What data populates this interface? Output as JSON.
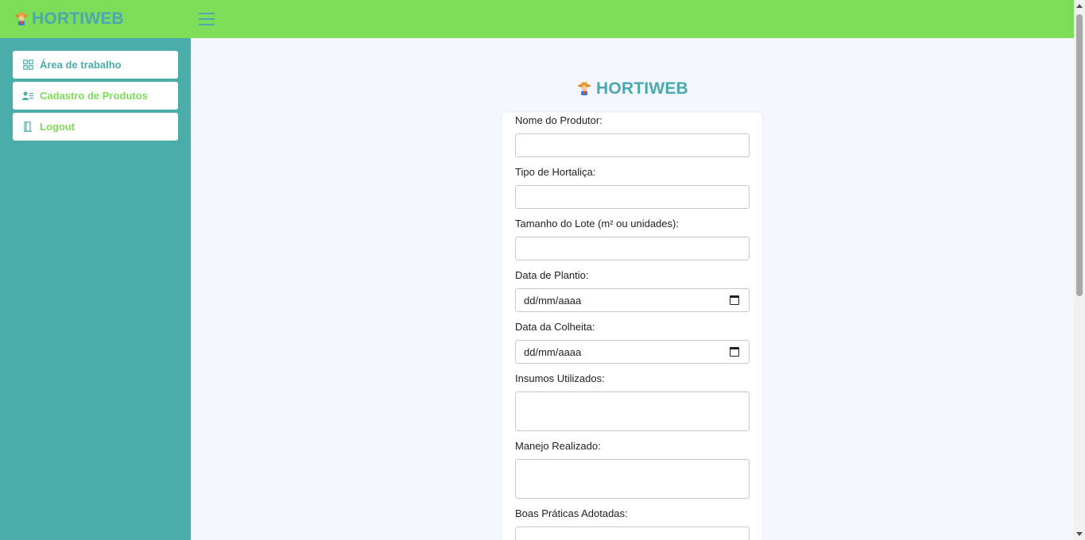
{
  "header": {
    "brand": "HORTIWEB",
    "logo_icon": "farmer-icon",
    "menu_icon": "hamburger-menu-icon"
  },
  "colors": {
    "topbar": "#7ddc58",
    "sidebar": "#4aada9",
    "brand_text": "#4aa8b0",
    "background": "#f4f7fe"
  },
  "sidebar": {
    "items": [
      {
        "label": "Área de trabalho",
        "icon": "dashboard-grid-icon"
      },
      {
        "label": "Cadastro de Produtos",
        "icon": "user-list-icon"
      },
      {
        "label": "Logout",
        "icon": "door-icon"
      }
    ]
  },
  "main": {
    "brand": "HORTIWEB"
  },
  "form": {
    "fields": [
      {
        "label": "Nome do Produtor:",
        "value": ""
      },
      {
        "label": "Tipo de Hortaliça:",
        "value": ""
      },
      {
        "label": "Tamanho do Lote (m² ou unidades):",
        "value": ""
      },
      {
        "label": "Data de Plantio:",
        "placeholder": "dd/mm/aaaa"
      },
      {
        "label": "Data da Colheita:",
        "placeholder": "dd/mm/aaaa"
      },
      {
        "label": "Insumos Utilizados:",
        "value": ""
      },
      {
        "label": "Manejo Realizado:",
        "value": ""
      },
      {
        "label": "Boas Práticas Adotadas:",
        "value": ""
      }
    ]
  }
}
